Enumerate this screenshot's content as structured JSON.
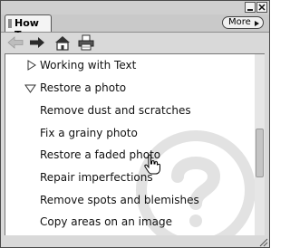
{
  "tab": {
    "title": "How To"
  },
  "more_button": {
    "label": "More"
  },
  "toolbar": {
    "back_icon": "back-arrow-icon",
    "forward_icon": "forward-arrow-icon",
    "home_icon": "home-icon",
    "print_icon": "printer-icon"
  },
  "topics": [
    {
      "label": "Working with Text",
      "state": "collapsed"
    },
    {
      "label": "Restore a photo",
      "state": "expanded"
    },
    {
      "label": "Remove dust and scratches"
    },
    {
      "label": "Fix a grainy photo"
    },
    {
      "label": "Restore a faded photo"
    },
    {
      "label": "Repair imperfections"
    },
    {
      "label": "Remove spots and blemishes"
    },
    {
      "label": "Copy areas on an image"
    }
  ],
  "colors": {
    "chrome": "#d9d9d9",
    "content_bg": "#ffffff",
    "text": "#111111",
    "watermark": "#e4e4e4"
  }
}
